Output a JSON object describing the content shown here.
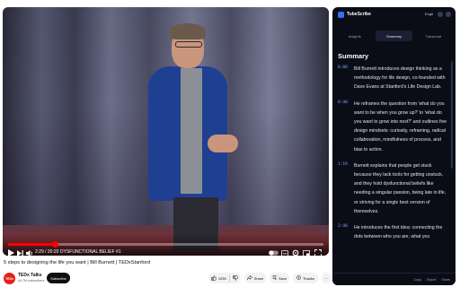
{
  "player": {
    "time": "2:29 / 20:20",
    "chapter": "DYSFUNCTIONAL BELIEF #1",
    "chapter_overlay": "DYSFUNCTIONAL BELIEF #1",
    "progress": 0.15
  },
  "video": {
    "title": "5 steps to designing the life you want | Bill Burnett | TEDxStanford",
    "channel": "TEDx Talks",
    "subscribers": "44.7M subscribers",
    "channel_badge": "TEDx",
    "subscribe_label": "Subscribe",
    "likes": "133K",
    "share": "Share",
    "save": "Save",
    "thanks": "Thanks"
  },
  "panel": {
    "app_name": "TubeScribe",
    "language": "Engli",
    "tabs": [
      {
        "label": "Insights"
      },
      {
        "label": "Summary"
      },
      {
        "label": "Transcript"
      }
    ],
    "active_tab": "Summary",
    "heading": "Summary",
    "entries": [
      {
        "time": "0:00",
        "text": "Bill Burnett introduces design thinking as a methodology for life design, co-founded with Dave Evans at Stanford's Life Design Lab."
      },
      {
        "time": "0:40",
        "text": "He reframes the question from 'what do you want to be when you grow up?' to 'what do you want to grow into next?' and outlines five design mindsets: curiosity, reframing, radical collaboration, mindfulness of process, and bias to action."
      },
      {
        "time": "1:19",
        "text": "Burnett explains that people get stuck because they lack tools for getting unstuck, and they hold dysfunctional beliefs like needing a singular passion, being late in life, or striving for a single best version of themselves."
      },
      {
        "time": "2:40",
        "text": "He introduces the first idea: connecting the dots between who you are, what you"
      }
    ],
    "footer": {
      "copy": "Copy",
      "export": "Export",
      "share": "Share"
    }
  }
}
